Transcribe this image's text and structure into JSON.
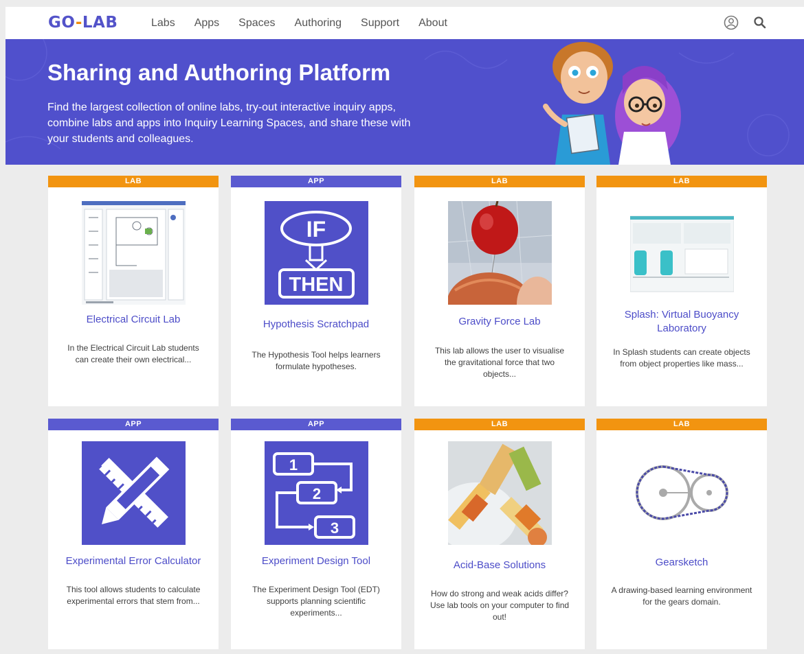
{
  "nav": {
    "logo_left": "GO",
    "logo_dash": "-",
    "logo_right": "LAB",
    "links": [
      "Labs",
      "Apps",
      "Spaces",
      "Authoring",
      "Support",
      "About"
    ],
    "icons": [
      "user-circle-icon",
      "search-icon"
    ]
  },
  "hero": {
    "title": "Sharing and Authoring Platform",
    "text": "Find the largest collection of online labs, try-out interactive inquiry apps, combine labs and apps into Inquiry Learning Spaces, and share these with your students and colleagues."
  },
  "cards": [
    {
      "type": "LAB",
      "title": "Electrical Circuit Lab",
      "desc": "In the Electrical Circuit Lab students can create their own electrical..."
    },
    {
      "type": "APP",
      "title": "Hypothesis Scratchpad",
      "desc": "The Hypothesis Tool helps learners formulate hypotheses.",
      "icon_text": [
        "IF",
        "THEN"
      ]
    },
    {
      "type": "LAB",
      "title": "Gravity Force Lab",
      "desc": "This lab allows the user to visualise the gravitational force that two objects..."
    },
    {
      "type": "LAB",
      "title": "Splash: Virtual Buoyancy Laboratory",
      "desc": "In Splash students can create objects from object properties like mass..."
    },
    {
      "type": "APP",
      "title": "Experimental Error Calculator",
      "desc": "This tool allows students to calculate experimental errors that stem from..."
    },
    {
      "type": "APP",
      "title": "Experiment Design Tool",
      "desc": "The Experiment Design Tool (EDT) supports planning scientific experiments...",
      "icon_text": [
        "1",
        "2",
        "3"
      ]
    },
    {
      "type": "LAB",
      "title": "Acid-Base Solutions",
      "desc": "How do strong and weak acids differ? Use lab tools on your computer to find out!"
    },
    {
      "type": "LAB",
      "title": "Gearsketch",
      "desc": "A drawing-based learning environment for the gears domain."
    }
  ],
  "colors": {
    "brand": "#5050cc",
    "lab_badge": "#f29410",
    "app_badge": "#5a5ad0",
    "link": "#4c4cc8"
  }
}
